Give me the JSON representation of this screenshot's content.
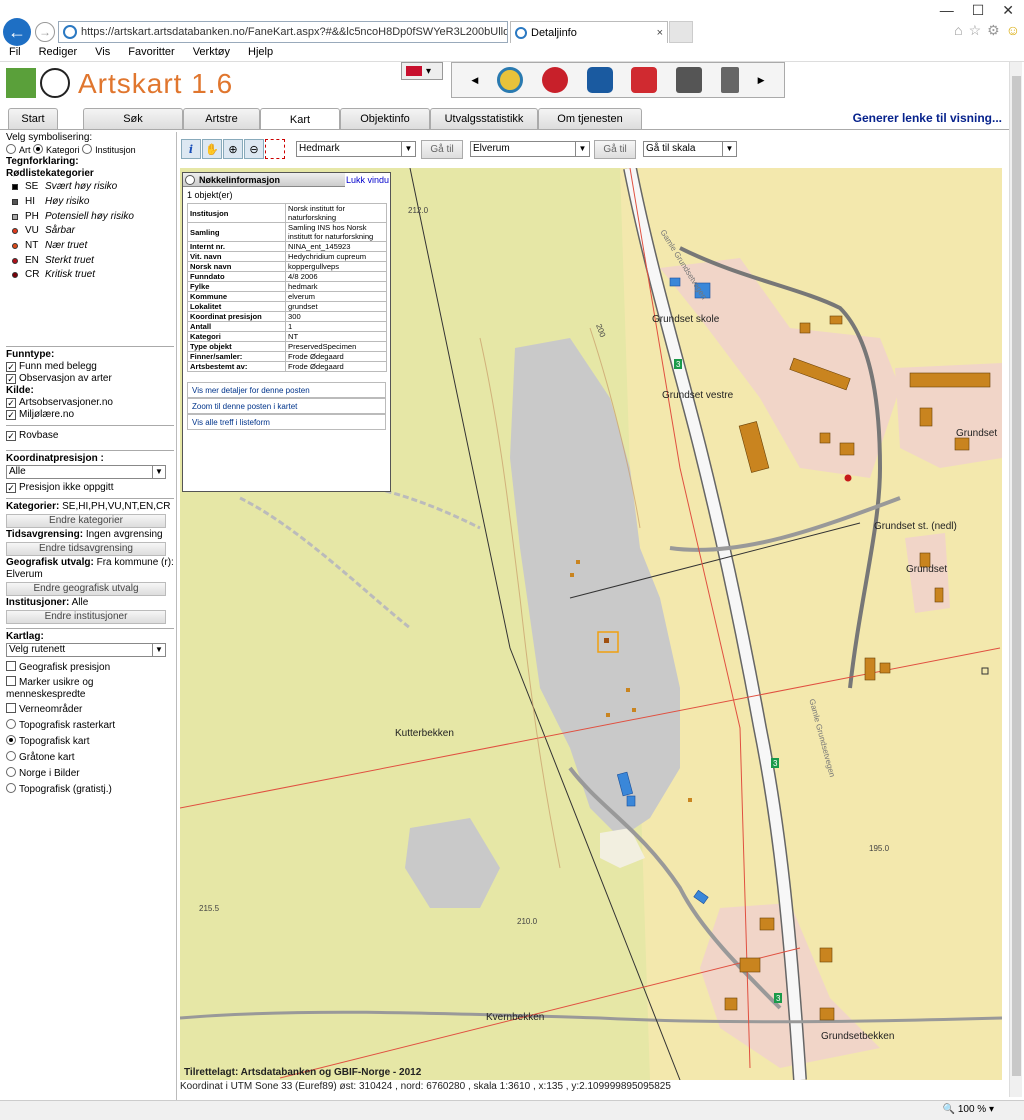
{
  "browser": {
    "url": "https://artskart.artsdatabanken.no/FaneKart.aspx?#&&lc5ncoH8Dp0fSWYeR3L200bUllqW7zY",
    "tab_title": "Detaljinfo",
    "menu": [
      "Fil",
      "Rediger",
      "Vis",
      "Favoritter",
      "Verktøy",
      "Hjelp"
    ],
    "zoom": "100 %"
  },
  "app": {
    "title": "Artskart 1.6",
    "tabs": [
      "Start",
      "Søk",
      "Artstre",
      "Kart",
      "Objektinfo",
      "Utvalgsstatistikk",
      "Om tjenesten"
    ],
    "active_tab": "Kart",
    "generate_link": "Generer lenke til visning..."
  },
  "sidebar": {
    "symbolisering_label": "Velg symbolisering:",
    "symbol_options": [
      "Art",
      "Kategori",
      "Institusjon"
    ],
    "legend_title": "Tegnforklaring:",
    "legend_subtitle": "Rødlistekategorier",
    "legend": [
      {
        "code": "SE",
        "desc": "Svært høy risiko",
        "color": "#000000"
      },
      {
        "code": "HI",
        "desc": "Høy risiko",
        "color": "#555555"
      },
      {
        "code": "PH",
        "desc": "Potensiell høy risiko",
        "color": "#aaaaaa"
      },
      {
        "code": "VU",
        "desc": "Sårbar",
        "color": "#e03a1e"
      },
      {
        "code": "NT",
        "desc": "Nær truet",
        "color": "#d94a1a"
      },
      {
        "code": "EN",
        "desc": "Sterkt truet",
        "color": "#b0101a"
      },
      {
        "code": "CR",
        "desc": "Kritisk truet",
        "color": "#7a0008"
      }
    ],
    "funntype_label": "Funntype:",
    "funntype": [
      "Funn med belegg",
      "Observasjon av arter"
    ],
    "kilde_label": "Kilde:",
    "kilde": [
      "Artsobservasjoner.no",
      "Miljølære.no"
    ],
    "rovbase": "Rovbase",
    "koordinat_label": "Koordinatpresisjon :",
    "koordinat_value": "Alle",
    "presisjon_ikke": "Presisjon ikke oppgitt",
    "kategorier_label": "Kategorier:",
    "kategorier_value": "SE,HI,PH,VU,NT,EN,CR",
    "endre_kategorier": "Endre kategorier",
    "tid_label": "Tidsavgrensing:",
    "tid_value": "Ingen avgrensing",
    "endre_tid": "Endre tidsavgrensing",
    "geo_label": "Geografisk utvalg:",
    "geo_value": "Fra kommune (r): Elverum",
    "endre_geo": "Endre geografisk utvalg",
    "inst_label": "Institusjoner:",
    "inst_value": "Alle",
    "endre_inst": "Endre institusjoner",
    "kartlag_label": "Kartlag:",
    "rutenett": "Velg rutenett",
    "kartlag_checks": [
      "Geografisk presisjon",
      "Marker usikre og menneskespredte",
      "Verneområder"
    ],
    "kartlag_radios": [
      "Topografisk rasterkart",
      "Topografisk kart",
      "Gråtone kart",
      "Norge i Bilder",
      "Topografisk (gratistj.)"
    ]
  },
  "toolbar": {
    "fylke": "Hedmark",
    "kommune": "Elverum",
    "ga_til": "Gå til",
    "skala": "Gå til skala"
  },
  "popup": {
    "title": "Nøkkelinformasjon",
    "close": "Lukk vindu",
    "count": "1 objekt(er)",
    "rows": [
      {
        "k": "Institusjon",
        "v": "Norsk institutt for naturforskning"
      },
      {
        "k": "Samling",
        "v": "Samling INS hos Norsk institutt for naturforskning"
      },
      {
        "k": "Internt nr.",
        "v": "NINA_ent_145923"
      },
      {
        "k": "Vit. navn",
        "v": "Hedychridium cupreum"
      },
      {
        "k": "Norsk navn",
        "v": "koppergullveps"
      },
      {
        "k": "Funndato",
        "v": "4/8 2006"
      },
      {
        "k": "Fylke",
        "v": "hedmark"
      },
      {
        "k": "Kommune",
        "v": "elverum"
      },
      {
        "k": "Lokalitet",
        "v": "grundset"
      },
      {
        "k": "Koordinat presisjon",
        "v": "300"
      },
      {
        "k": "Antall",
        "v": "1"
      },
      {
        "k": "Kategori",
        "v": "NT"
      },
      {
        "k": "Type objekt",
        "v": "PreservedSpecimen"
      },
      {
        "k": "Finner/samler:",
        "v": "Frode Ødegaard"
      },
      {
        "k": "Artsbestemt av:",
        "v": "Frode Ødegaard"
      }
    ],
    "links": [
      "Vis mer detaljer for denne posten",
      "Zoom til denne posten i kartet",
      "Vis alle treff i listeform"
    ]
  },
  "map": {
    "labels": {
      "grundset_skole": "Grundset skole",
      "grundset_vestre": "Grundset vestre",
      "grundset": "Grundset",
      "grundset_st": "Grundset st. (nedl)",
      "grundset2": "Grundset",
      "kutterbekken": "Kutterbekken",
      "kvernbekken": "Kvernbekken",
      "grundsetbekken": "Grundsetbekken",
      "h2120": "212.0",
      "h2155": "215.5",
      "h2100": "210.0",
      "h1950": "195.0",
      "h200": "200",
      "road3a": "3",
      "road3b": "3",
      "road3c": "3",
      "vegnavn1": "Gamle Grundsetvegen",
      "vegnavn2": "Gamle Grundsetvegen"
    },
    "credit": "Tilrettelagt: Artsdatabanken og GBIF-Norge - 2012",
    "coord": "Koordinat i UTM Sone 33 (Euref89) øst: 310424 , nord: 6760280 , skala 1:3610 , x:135 , y:2.109999895095825"
  }
}
